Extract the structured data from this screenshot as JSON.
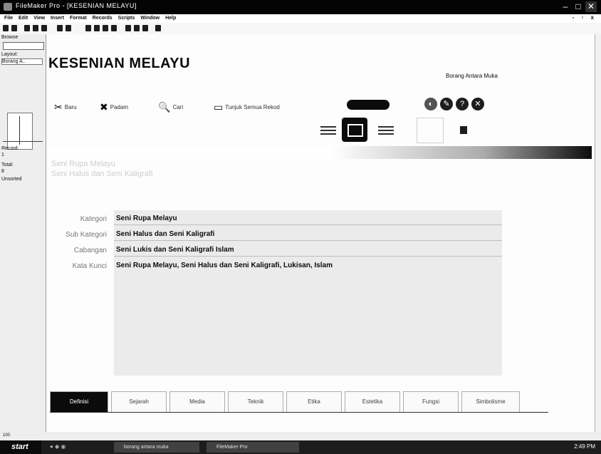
{
  "window": {
    "title": "FileMaker Pro - [KESENIAN MELAYU]"
  },
  "menu": [
    "File",
    "Edit",
    "View",
    "Insert",
    "Format",
    "Records",
    "Scripts",
    "Window",
    "Help"
  ],
  "status_area": {
    "mode": "Browse",
    "layout_label": "Layout:",
    "layout_value": "Borang A..",
    "record_label": "Record:",
    "record_value": "1",
    "total_label": "Total:",
    "total_value": "8",
    "sort_state": "Unsorted"
  },
  "page": {
    "heading": "KESENIAN MELAYU",
    "subtitle_right": "Borang Antara Muka"
  },
  "toolbar": {
    "new_label": "Baru",
    "delete_label": "Padam",
    "find_label": "Cari",
    "show_all_label": "Tunjuk Semua Rekod"
  },
  "ghost_text": {
    "line1": "Seni Rupa Melayu",
    "line2": "Seni Halus dan Seni Kaligrafi"
  },
  "fields": [
    {
      "label": "Kategori",
      "value": "Seni Rupa Melayu"
    },
    {
      "label": "Sub Kategori",
      "value": "Seni Halus dan Seni Kaligrafi"
    },
    {
      "label": "Cabangan",
      "value": "Seni Lukis dan Seni Kaligrafi Islam"
    },
    {
      "label": "Kata Kunci",
      "value": "Seni Rupa Melayu, Seni Halus dan Seni Kaligrafi, Lukisan, Islam"
    }
  ],
  "tabs": [
    "Definisi",
    "Sejarah",
    "Media",
    "Teknik",
    "Etika",
    "Estetika",
    "Fungsi",
    "Simbolisme"
  ],
  "taskbar": {
    "start_label": "start",
    "items": [
      "borang antara muka",
      "FileMaker Pro"
    ],
    "clock": "2:49 PM"
  },
  "bottom_strip": {
    "zoom": "100"
  }
}
